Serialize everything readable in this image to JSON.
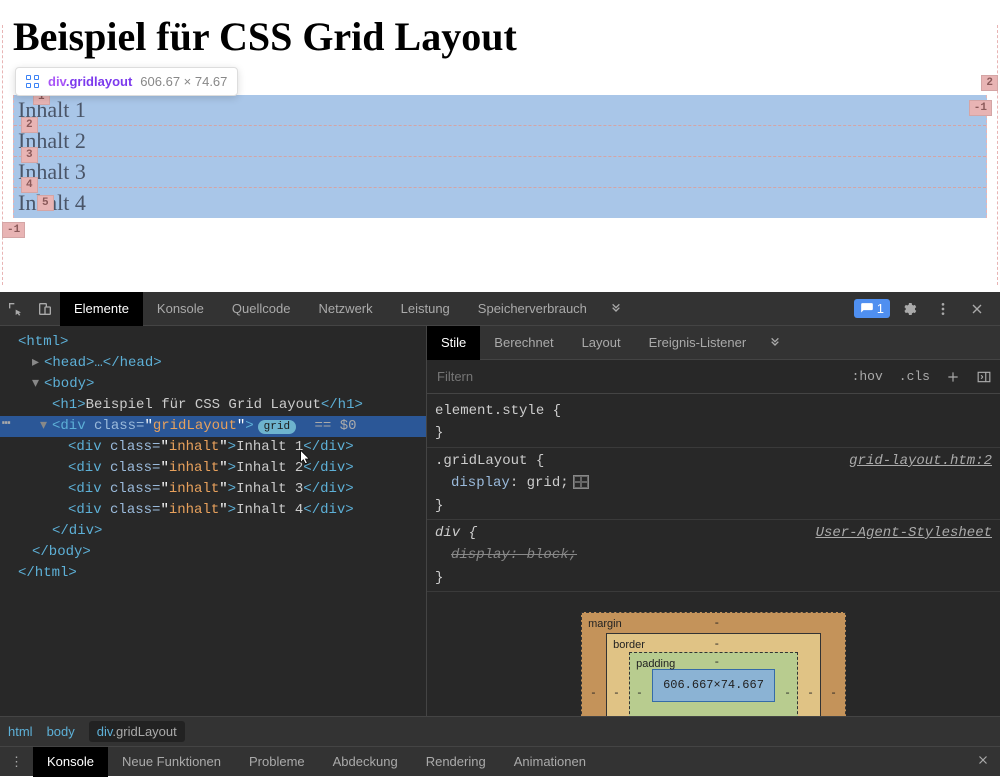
{
  "page": {
    "title": "Beispiel für CSS Grid Layout",
    "tooltip": {
      "tag": "div",
      "cls": ".gridlayout",
      "dims": "606.67 × 74.67"
    },
    "grid_markers": [
      "1",
      "2",
      "3",
      "4",
      "5",
      "-1",
      "2",
      "-1"
    ],
    "inhalte": [
      "Inhalt 1",
      "Inhalt 2",
      "Inhalt 3",
      "Inhalt 4"
    ]
  },
  "devtools": {
    "tabs": [
      "Elemente",
      "Konsole",
      "Quellcode",
      "Netzwerk",
      "Leistung",
      "Speicherverbrauch"
    ],
    "issue_count": "1",
    "dom": {
      "html_open": "<html>",
      "head": "<head>…</head>",
      "body_open": "<body>",
      "h1": "Beispiel für CSS Grid Layout",
      "gridlayout_class": "gridLayout",
      "grid_pill": "grid",
      "selected_marker": "== $0",
      "inhalt_class": "inhalt",
      "inhalt_items": [
        "Inhalt 1",
        "Inhalt 2",
        "Inhalt 3",
        "Inhalt 4"
      ],
      "div_close": "</div>",
      "body_close": "</body>",
      "html_close": "</html>"
    },
    "styles_tabs": [
      "Stile",
      "Berechnet",
      "Layout",
      "Ereignis-Listener"
    ],
    "filter_placeholder": "Filtern",
    "filter_btns": [
      ":hov",
      ".cls"
    ],
    "rules": {
      "element_style": "element.style {",
      "gridlayout_sel": ".gridLayout {",
      "gridlayout_link": "grid-layout.htm:2",
      "display_grid_prop": "display",
      "display_grid_val": "grid",
      "div_sel": "div {",
      "ua_link": "User-Agent-Stylesheet",
      "display_block": "display: block;",
      "brace_close": "}"
    },
    "box_model": {
      "margin": "margin",
      "border": "border",
      "padding": "padding",
      "content": "606.667×74.667",
      "dash": "-"
    },
    "breadcrumb": [
      "html",
      "body",
      "div.gridLayout"
    ],
    "console_tabs": [
      "Konsole",
      "Neue Funktionen",
      "Probleme",
      "Abdeckung",
      "Rendering",
      "Animationen"
    ]
  }
}
